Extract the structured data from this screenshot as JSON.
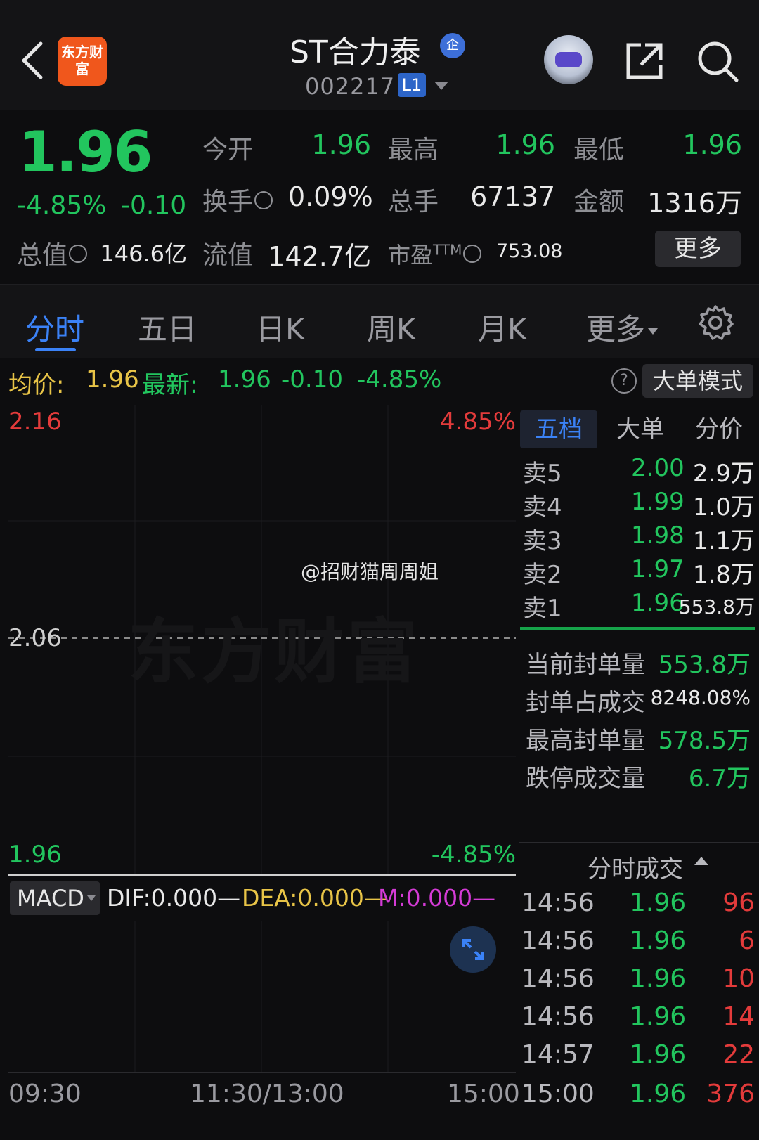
{
  "header": {
    "logo_text": "东方财富",
    "stock_name": "ST合力泰",
    "badge": "企",
    "stock_code": "002217",
    "level": "L1"
  },
  "quote": {
    "price": "1.96",
    "change_pct": "-4.85%",
    "change": "-0.10",
    "open_label": "今开",
    "open": "1.96",
    "high_label": "最高",
    "high": "1.96",
    "low_label": "最低",
    "low": "1.96",
    "turnover_label": "换手",
    "turnover": "0.09%",
    "volume_label": "总手",
    "volume": "67137",
    "amount_label": "金额",
    "amount": "1316万",
    "total_cap_label": "总值",
    "total_cap": "146.6亿",
    "float_cap_label": "流值",
    "float_cap": "142.7亿",
    "pe_label": "市盈",
    "pe_sup": "TTM",
    "pe": "753.08",
    "more_label": "更多"
  },
  "tabs": [
    "分时",
    "五日",
    "日K",
    "周K",
    "月K",
    "更多"
  ],
  "info_line": {
    "avg_label": "均价:",
    "avg": "1.96",
    "latest_label": "最新:",
    "latest": "1.96",
    "change": "-0.10",
    "change_pct": "-4.85%",
    "help": "?",
    "big_order_label": "大单模式"
  },
  "chart": {
    "y_top": "2.16",
    "y_top_pct": "4.85%",
    "y_mid": "2.06",
    "y_bottom": "1.96",
    "y_bottom_pct": "-4.85%",
    "watermark": "东方财富",
    "weibo": "@招财猫周周姐",
    "x_labels": [
      "09:30",
      "11:30/13:00",
      "15:00"
    ]
  },
  "macd": {
    "label": "MACD",
    "dif": "DIF:0.000—",
    "dea": "DEA:0.000—",
    "m": "M:0.000—"
  },
  "order_book": {
    "tabs": [
      "五档",
      "大单",
      "分价"
    ],
    "rows": [
      {
        "label": "卖5",
        "price": "2.00",
        "vol": "2.9万"
      },
      {
        "label": "卖4",
        "price": "1.99",
        "vol": "1.0万"
      },
      {
        "label": "卖3",
        "price": "1.98",
        "vol": "1.1万"
      },
      {
        "label": "卖2",
        "price": "1.97",
        "vol": "1.8万"
      },
      {
        "label": "卖1",
        "price": "1.96",
        "vol": "553.8万"
      }
    ],
    "seal": [
      {
        "label": "当前封单量",
        "value": "553.8万"
      },
      {
        "label": "封单占成交",
        "value": "8248.08%"
      },
      {
        "label": "最高封单量",
        "value": "578.5万"
      },
      {
        "label": "跌停成交量",
        "value": "6.7万"
      }
    ]
  },
  "trades": {
    "header": "分时成交",
    "rows": [
      {
        "time": "14:56",
        "price": "1.96",
        "vol": "96"
      },
      {
        "time": "14:56",
        "price": "1.96",
        "vol": "6"
      },
      {
        "time": "14:56",
        "price": "1.96",
        "vol": "10"
      },
      {
        "time": "14:56",
        "price": "1.96",
        "vol": "14"
      },
      {
        "time": "14:57",
        "price": "1.96",
        "vol": "22"
      },
      {
        "time": "15:00",
        "price": "1.96",
        "vol": "376"
      }
    ]
  }
}
